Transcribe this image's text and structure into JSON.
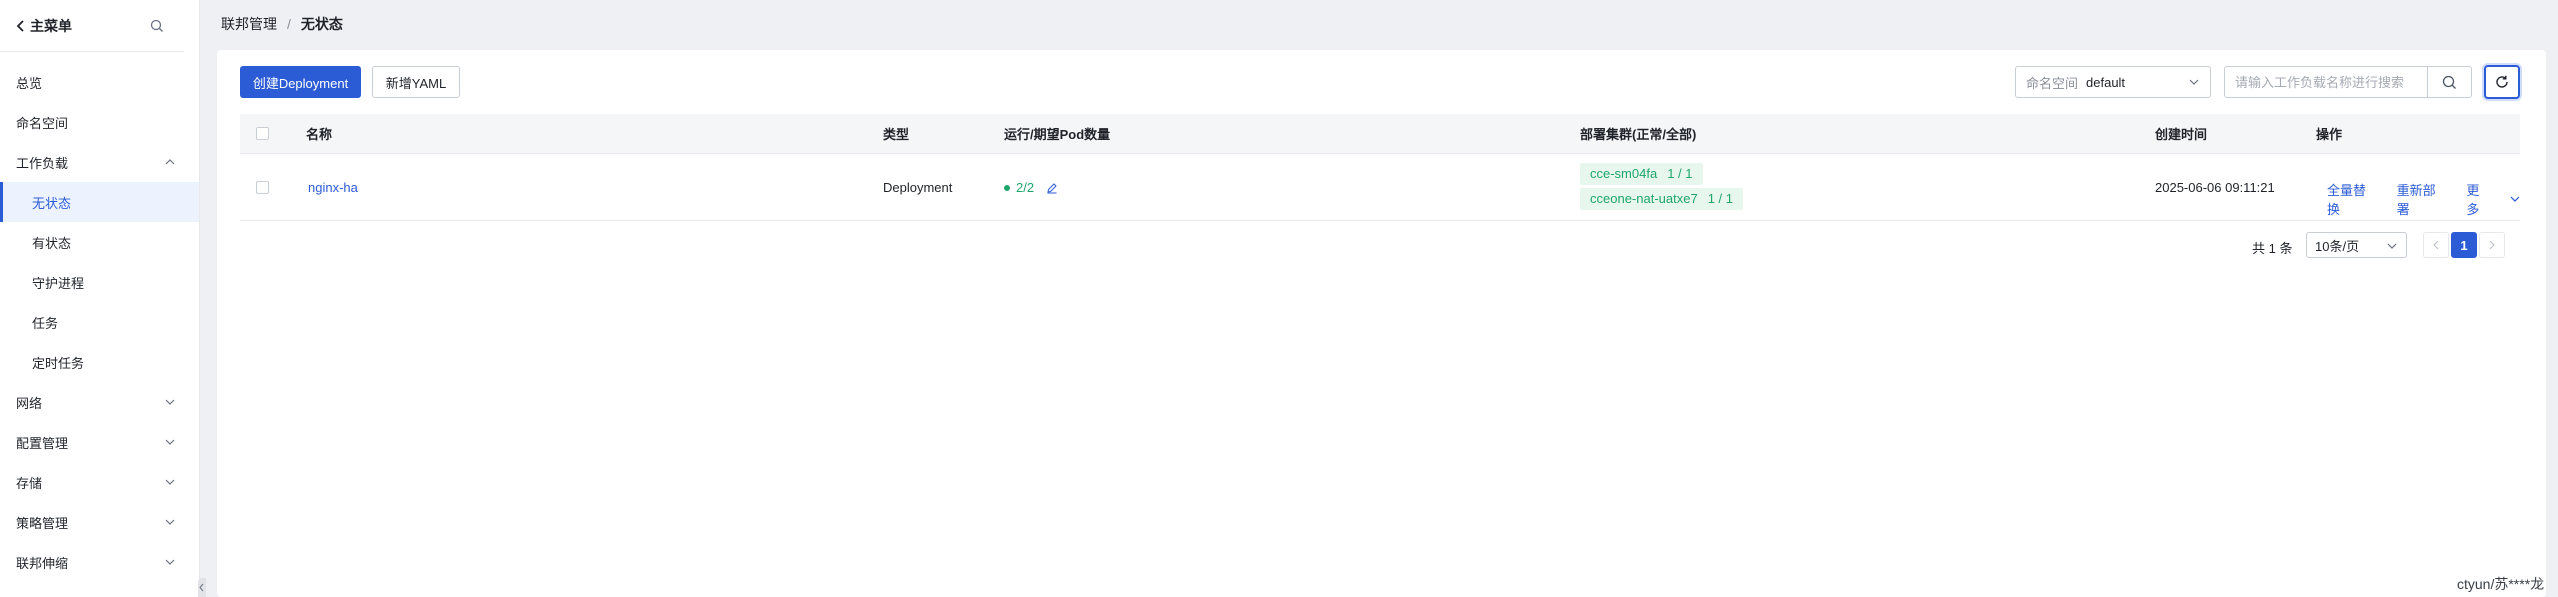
{
  "sidebar": {
    "back_label": "主菜单",
    "items": [
      {
        "label": "总览"
      },
      {
        "label": "命名空间"
      },
      {
        "label": "工作负载"
      },
      {
        "label": "无状态"
      },
      {
        "label": "有状态"
      },
      {
        "label": "守护进程"
      },
      {
        "label": "任务"
      },
      {
        "label": "定时任务"
      },
      {
        "label": "网络"
      },
      {
        "label": "配置管理"
      },
      {
        "label": "存储"
      },
      {
        "label": "策略管理"
      },
      {
        "label": "联邦伸缩"
      }
    ],
    "active_item": "无状态"
  },
  "breadcrumb": {
    "parent": "联邦管理",
    "separator": "/",
    "current": "无状态"
  },
  "toolbar": {
    "create_label": "创建Deployment",
    "add_yaml_label": "新增YAML",
    "namespace_label": "命名空间",
    "namespace_value": "default",
    "search_placeholder": "请输入工作负载名称进行搜索"
  },
  "table": {
    "headers": {
      "name": "名称",
      "type": "类型",
      "pods": "运行/期望Pod数量",
      "clusters": "部署集群(正常/全部)",
      "created": "创建时间",
      "actions": "操作"
    },
    "rows": [
      {
        "name": "nginx-ha",
        "type": "Deployment",
        "pods": "2/2",
        "clusters": [
          {
            "name": "cce-sm04fa",
            "count": "1 / 1"
          },
          {
            "name": "cceone-nat-uatxe7",
            "count": "1 / 1"
          }
        ],
        "created": "2025-06-06 09:11:21",
        "actions": {
          "replace": "全量替换",
          "redeploy": "重新部署",
          "more": "更多"
        }
      }
    ]
  },
  "pagination": {
    "total": "共 1 条",
    "page_size": "10条/页",
    "current_page": "1"
  },
  "watermark": "ctyun/苏****龙",
  "colors": {
    "primary": "#2b5cd6",
    "success": "#1fa56b",
    "success_bg": "#e7f7ee"
  }
}
